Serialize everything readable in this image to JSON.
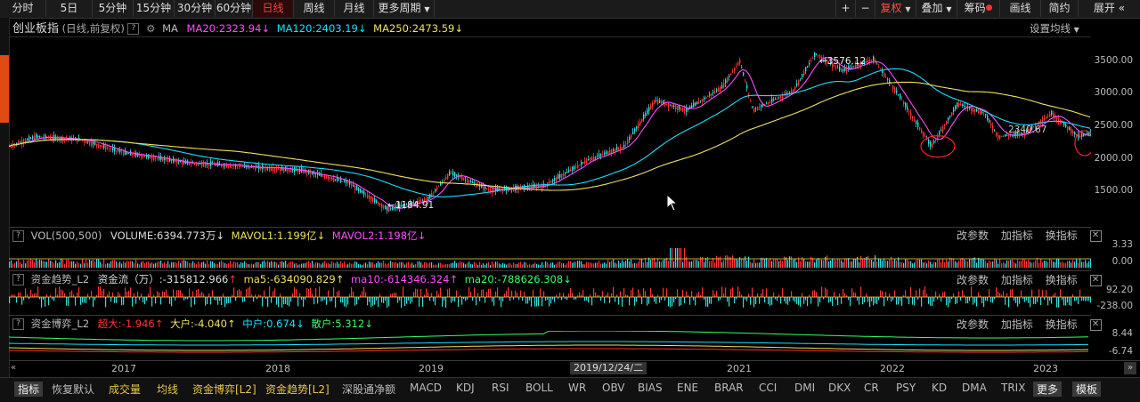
{
  "toolbar": {
    "periods": [
      "分时",
      "5日",
      "5分钟",
      "15分钟",
      "30分钟",
      "60分钟",
      "日线",
      "周线",
      "月线",
      "更多周期"
    ],
    "active_period": "日线",
    "right": [
      "+",
      "−",
      "复权",
      "叠加",
      "筹码",
      "画线",
      "简约",
      "展开"
    ]
  },
  "main_panel": {
    "name": "创业板指",
    "mode": "(日线,前复权)",
    "ma_label": "MA",
    "ma20": "MA20:2323.94",
    "ma120": "MA120:2403.19",
    "ma250": "MA250:2473.59",
    "settings": "设置均线",
    "high_label": "3576.12",
    "low_label": "1184.91",
    "mid_label": "2340.67",
    "axis": [
      "3500.00",
      "3000.00",
      "2500.00",
      "2000.00",
      "1500.00"
    ],
    "colors": {
      "ma20": "#ff4cff",
      "ma120": "#18e0ff",
      "ma250": "#f0e060",
      "up": "#ff3333",
      "down": "#33dddd"
    }
  },
  "vol_panel": {
    "name": "VOL(500,500)",
    "volume": "VOLUME:6394.773万",
    "mavol1": "MAVOL1:1.199亿",
    "mavol2": "MAVOL2:1.198亿",
    "axis": [
      "3.33",
      "0.00"
    ]
  },
  "flow_panel": {
    "name": "资金趋势_L2",
    "flow": "资金流（万）:-315812.966",
    "ma5": "ma5:-634090.829",
    "ma10": "ma10:-614346.324",
    "ma20": "ma20:-788626.308",
    "axis": [
      "92.20",
      "-238.00"
    ]
  },
  "game_panel": {
    "name": "资金博弈_L2",
    "super": "超大:-1.946",
    "big": "大户:-4.040",
    "mid": "中户:0.674",
    "retail": "散户:5.312",
    "axis": [
      "8.44",
      "-6.74"
    ]
  },
  "panel_tools": [
    "改参数",
    "加指标",
    "换指标"
  ],
  "time_axis": {
    "years": [
      "2017",
      "2018",
      "2019",
      "2021",
      "2022",
      "2023"
    ],
    "cursor_date": "2019/12/24/二"
  },
  "bottom": [
    "指标",
    "恢复默认",
    "成交量",
    "均线",
    "资金博弈[L2]",
    "资金趋势[L2]",
    "深股通净额",
    "MACD",
    "KDJ",
    "RSI",
    "BOLL",
    "WR",
    "OBV",
    "BIAS",
    "ENE",
    "BRAR",
    "CCI",
    "DMI",
    "DKX",
    "CR",
    "PSY",
    "KD",
    "DMA",
    "TRIX",
    "更多",
    "模板"
  ]
}
